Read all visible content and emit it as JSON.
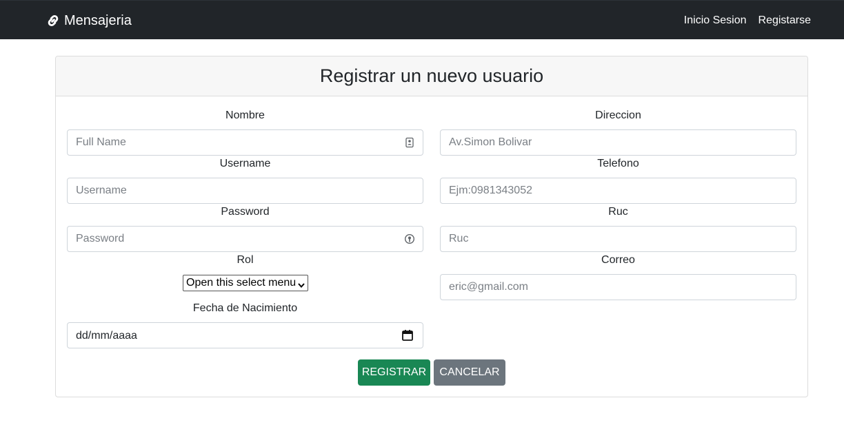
{
  "navbar": {
    "brand": "Mensajeria",
    "brand_icon": "link-icon",
    "links": [
      "Inicio Sesion",
      "Registarse"
    ]
  },
  "form": {
    "title": "Registrar un nuevo usuario",
    "left": {
      "nombre": {
        "label": "Nombre",
        "placeholder": "Full Name",
        "icon": "contact-card-icon"
      },
      "username": {
        "label": "Username",
        "placeholder": "Username"
      },
      "password": {
        "label": "Password",
        "placeholder": "Password",
        "icon": "password-key-icon"
      },
      "rol": {
        "label": "Rol",
        "selected": "Open this select menu"
      },
      "fecha": {
        "label": "Fecha de Nacimiento",
        "value": "dd/mm/aaaa",
        "icon": "calendar-icon"
      }
    },
    "right": {
      "direccion": {
        "label": "Direccion",
        "placeholder": "Av.Simon Bolivar"
      },
      "telefono": {
        "label": "Telefono",
        "placeholder": "Ejm:0981343052"
      },
      "ruc": {
        "label": "Ruc",
        "placeholder": "Ruc"
      },
      "correo": {
        "label": "Correo",
        "placeholder": "eric@gmail.com"
      }
    },
    "buttons": {
      "submit": "REGISTRAR",
      "cancel": "CANCELAR"
    }
  },
  "colors": {
    "navbar": "#212529",
    "success": "#198754",
    "secondary": "#6c757d"
  }
}
